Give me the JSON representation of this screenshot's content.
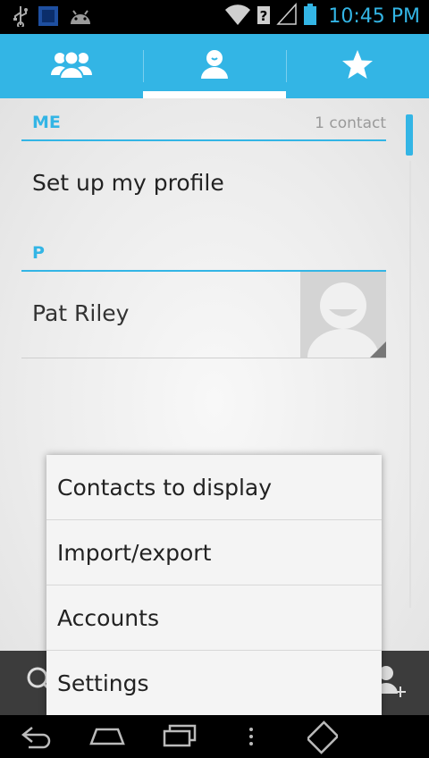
{
  "status_bar": {
    "time": "10:45 PM",
    "icons_left": [
      "usb-icon",
      "sim-app-icon",
      "android-icon"
    ],
    "icons_right": [
      "wifi-icon",
      "signal-unknown-icon",
      "battery-icon"
    ]
  },
  "tabs": [
    {
      "name": "groups",
      "icon": "groups-icon",
      "active": false
    },
    {
      "name": "all-contacts",
      "icon": "person-icon",
      "active": true
    },
    {
      "name": "favorites",
      "icon": "star-icon",
      "active": false
    }
  ],
  "sections": {
    "me": {
      "title": "ME",
      "count": "1 contact",
      "item": "Set up my profile"
    },
    "p": {
      "title": "P",
      "contact": "Pat Riley"
    }
  },
  "menu": {
    "items": [
      "Contacts to display",
      "Import/export",
      "Accounts",
      "Settings"
    ]
  },
  "colors": {
    "accent": "#33b5e5"
  }
}
